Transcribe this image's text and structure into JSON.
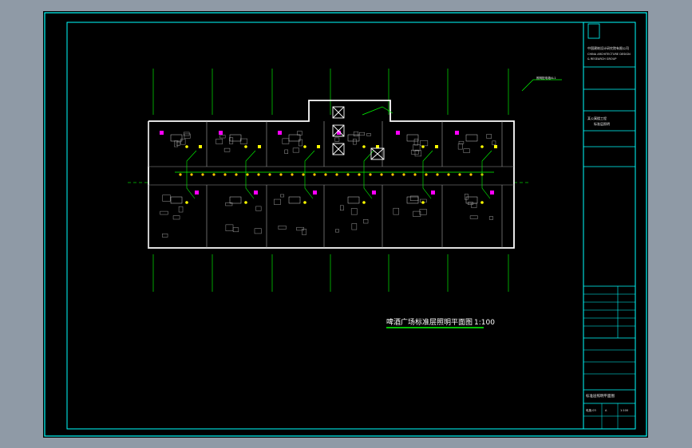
{
  "drawing": {
    "title": "啤酒广场标准层照明平面图",
    "scale": "1:100",
    "leader_note": "照明配电箱AL1"
  },
  "title_block": {
    "company_lines": [
      "中国建筑设计研究院有限公司",
      "CHINA ARCHITECTURE DESIGN",
      "& RESEARCH GROUP"
    ],
    "project_lines": [
      "某公寓楼工程",
      "标准层照明"
    ],
    "sheet_title": "标准层照明平面图",
    "drawing_no": "电施-03",
    "revision": "A",
    "scale_value": "1:100"
  },
  "colors": {
    "background": "#000000",
    "frame": "#00ffff",
    "walls": "#ffffff",
    "grid": "#00ff00",
    "fixture": "#ffff00",
    "accent": "#ff00ff",
    "title_underline": "#00ff00"
  }
}
